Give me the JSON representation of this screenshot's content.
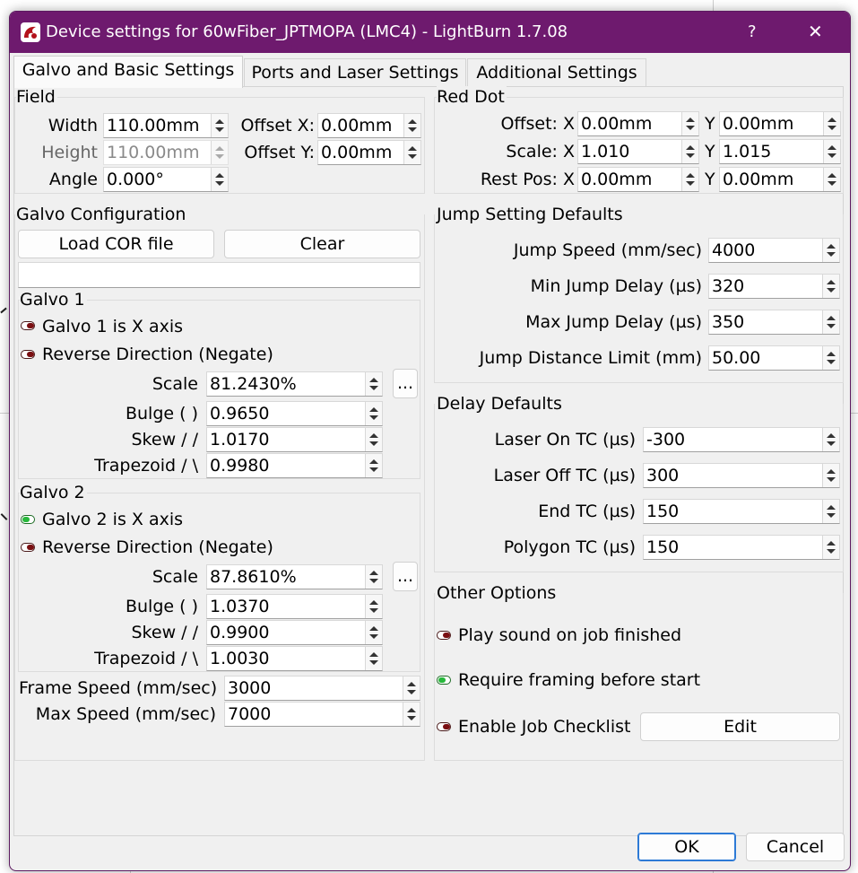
{
  "window": {
    "title": "Device settings for 60wFiber_JPTMOPA (LMC4) - LightBurn 1.7.08",
    "help_glyph": "?",
    "close_glyph": "✕",
    "app_icon": "lightburn-logo-icon"
  },
  "tabs": [
    {
      "label": "Galvo and Basic Settings",
      "active": true
    },
    {
      "label": "Ports and Laser Settings",
      "active": false
    },
    {
      "label": "Additional Settings",
      "active": false
    }
  ],
  "field": {
    "title": "Field",
    "width_label": "Width",
    "width_value": "110.00mm",
    "height_label": "Height",
    "height_value": "110.00mm",
    "angle_label": "Angle",
    "angle_value": "0.000°",
    "offset_x_label": "Offset X:",
    "offset_x_value": "0.00mm",
    "offset_y_label": "Offset Y:",
    "offset_y_value": "0.00mm"
  },
  "red_dot": {
    "title": "Red Dot",
    "offset_label": "Offset: X",
    "offset_x": "0.00mm",
    "offset_y": "0.00mm",
    "scale_label": "Scale: X",
    "scale_x": "1.010",
    "scale_y": "1.015",
    "rest_label": "Rest Pos: X",
    "rest_x": "0.00mm",
    "rest_y": "0.00mm",
    "y_label": "Y"
  },
  "galvo_config": {
    "title": "Galvo Configuration",
    "load_cor_label": "Load COR file",
    "clear_label": "Clear",
    "cor_path": "",
    "more_label": "...",
    "galvo1": {
      "title": "Galvo 1",
      "is_x_label": "Galvo 1 is X axis",
      "is_x_on": false,
      "reverse_label": "Reverse Direction (Negate)",
      "reverse_on": false,
      "scale_label": "Scale",
      "scale_value": "81.2430%",
      "bulge_label": "Bulge (  )",
      "bulge_value": "0.9650",
      "skew_label": "Skew  / /",
      "skew_value": "1.0170",
      "trapezoid_label": "Trapezoid  / \\",
      "trapezoid_value": "0.9980"
    },
    "galvo2": {
      "title": "Galvo 2",
      "is_x_label": "Galvo 2 is X axis",
      "is_x_on": true,
      "reverse_label": "Reverse Direction (Negate)",
      "reverse_on": false,
      "scale_label": "Scale",
      "scale_value": "87.8610%",
      "bulge_label": "Bulge (  )",
      "bulge_value": "1.0370",
      "skew_label": "Skew  / /",
      "skew_value": "0.9900",
      "trapezoid_label": "Trapezoid  / \\",
      "trapezoid_value": "1.0030"
    },
    "frame_speed_label": "Frame Speed (mm/sec)",
    "frame_speed_value": "3000",
    "max_speed_label": "Max Speed (mm/sec)",
    "max_speed_value": "7000"
  },
  "jump": {
    "title": "Jump Setting Defaults",
    "speed_label": "Jump Speed (mm/sec)",
    "speed_value": "4000",
    "min_delay_label": "Min Jump Delay (µs)",
    "min_delay_value": "320",
    "max_delay_label": "Max Jump Delay (µs)",
    "max_delay_value": "350",
    "distance_label": "Jump Distance Limit (mm)",
    "distance_value": "50.00"
  },
  "delay": {
    "title": "Delay Defaults",
    "laser_on_label": "Laser On TC (µs)",
    "laser_on_value": "-300",
    "laser_off_label": "Laser Off TC (µs)",
    "laser_off_value": "300",
    "end_label": "End TC (µs)",
    "end_value": "150",
    "polygon_label": "Polygon TC (µs)",
    "polygon_value": "150"
  },
  "other": {
    "title": "Other Options",
    "play_sound_label": "Play sound on job finished",
    "play_sound_on": false,
    "require_framing_label": "Require framing before start",
    "require_framing_on": true,
    "checklist_label": "Enable Job Checklist",
    "checklist_on": false,
    "edit_label": "Edit"
  },
  "footer": {
    "ok_label": "OK",
    "cancel_label": "Cancel"
  },
  "colors": {
    "titlebar": "#6e1a6e",
    "toggle_off": "#7a0f12",
    "toggle_on": "#27b83b",
    "focus": "#2d7ad6"
  }
}
